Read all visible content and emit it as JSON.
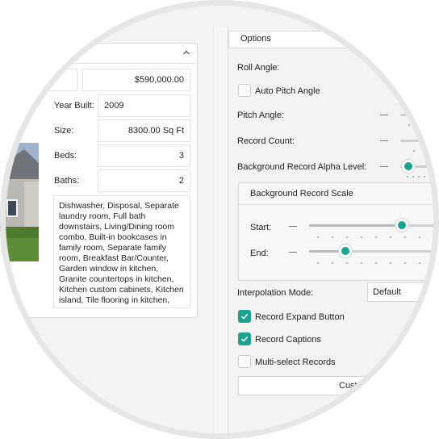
{
  "listing": {
    "price": "$590,000.00",
    "year_built_label": "Year Built:",
    "year_built": "2009",
    "size_label": "Size:",
    "size": "8300.00 Sq Ft",
    "beds_label": "Beds:",
    "beds": "3",
    "baths_label": "Baths:",
    "baths": "2",
    "description": "Dishwasher, Disposal, Separate laundry room, Full bath downstairs, Living/Dining room combo, Built-in bookcases in family room, Separate family room, Breakfast Bar/Counter, Garden window in kitchen, Granite countertops in kitchen, Kitchen custom cabinets, Kitchen island, Tile flooring in kitchen,"
  },
  "options": {
    "tab_label": "Options",
    "roll_angle_label": "Roll Angle:",
    "auto_pitch_label": "Auto Pitch Angle",
    "pitch_angle_label": "Pitch Angle:",
    "record_count_label": "Record Count:",
    "bg_alpha_label": "Background Record Alpha Level:",
    "bg_alpha_value": 0.0,
    "scale_group_label": "Background Record Scale",
    "start_label": "Start:",
    "start_value": 0.72,
    "end_label": "End:",
    "end_value": 0.28,
    "interp_label": "Interpolation Mode:",
    "interp_value": "Default",
    "expand_button_label": "Record Expand Button",
    "expand_button_checked": true,
    "captions_label": "Record Captions",
    "captions_checked": true,
    "multiselect_label": "Multi-select Records",
    "multiselect_checked": false,
    "custom_button_label": "Custo"
  },
  "colors": {
    "accent": "#1aa38e"
  }
}
